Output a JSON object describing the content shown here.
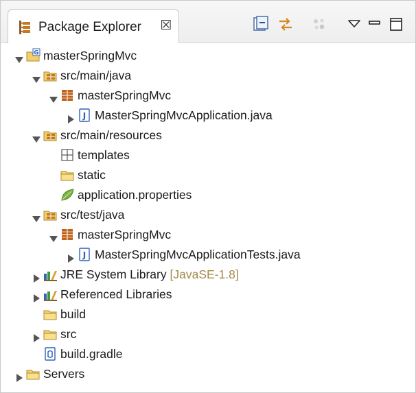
{
  "view": {
    "tab_label": "Package Explorer",
    "tab_close_glyph": "☒",
    "toolbar": [
      {
        "name": "collapse-all-button",
        "icon": "collapse-all-icon"
      },
      {
        "name": "link-with-editor-button",
        "icon": "link-with-editor-icon"
      },
      {
        "name": "focus-active-task-button",
        "icon": "focus-active-task-icon",
        "disabled": true
      },
      {
        "name": "view-menu-button",
        "icon": "view-menu-icon"
      },
      {
        "name": "minimize-button",
        "icon": "minimize-icon"
      },
      {
        "name": "maximize-button",
        "icon": "maximize-icon"
      }
    ]
  },
  "tree": {
    "nodes": [
      {
        "label": "masterSpringMvc",
        "icon": "gradle-project-icon",
        "twisty": "expanded"
      },
      {
        "label": "src/main/java",
        "icon": "source-folder-icon",
        "twisty": "expanded"
      },
      {
        "label": "masterSpringMvc",
        "icon": "package-icon",
        "twisty": "expanded"
      },
      {
        "label": "MasterSpringMvcApplication.java",
        "icon": "java-file-icon",
        "twisty": "collapsed"
      },
      {
        "label": "src/main/resources",
        "icon": "source-folder-icon",
        "twisty": "expanded"
      },
      {
        "label": "templates",
        "icon": "empty-package-icon",
        "twisty": "none"
      },
      {
        "label": "static",
        "icon": "folder-icon",
        "twisty": "none"
      },
      {
        "label": "application.properties",
        "icon": "spring-leaf-icon",
        "twisty": "none"
      },
      {
        "label": "src/test/java",
        "icon": "source-folder-icon",
        "twisty": "expanded"
      },
      {
        "label": "masterSpringMvc",
        "icon": "package-icon",
        "twisty": "expanded"
      },
      {
        "label": "MasterSpringMvcApplicationTests.java",
        "icon": "java-file-icon",
        "twisty": "collapsed"
      },
      {
        "label": "JRE System Library",
        "qualifier": "[JavaSE-1.8]",
        "icon": "library-icon",
        "twisty": "collapsed"
      },
      {
        "label": "Referenced Libraries",
        "icon": "library-icon",
        "twisty": "collapsed"
      },
      {
        "label": "build",
        "icon": "folder-icon",
        "twisty": "none"
      },
      {
        "label": "src",
        "icon": "folder-icon",
        "twisty": "collapsed"
      },
      {
        "label": "build.gradle",
        "icon": "gradle-file-icon",
        "twisty": "none"
      },
      {
        "label": "Servers",
        "icon": "folder-icon",
        "twisty": "collapsed"
      }
    ]
  },
  "colors": {
    "qualifier": "#a58a4a",
    "package": "#b5521d",
    "folder": "#f0c64a",
    "java_file": "#2f62b8",
    "leaf": "#7cb342"
  }
}
